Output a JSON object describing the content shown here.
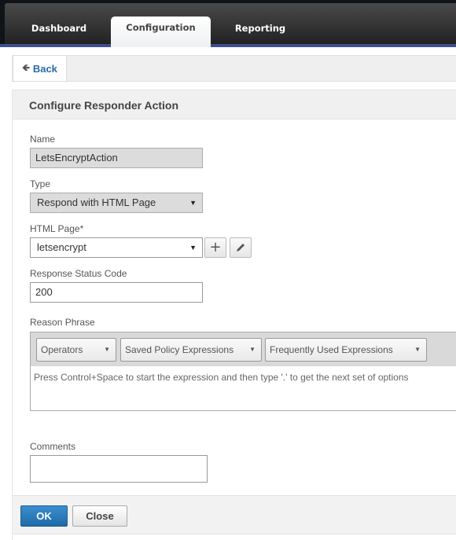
{
  "nav": {
    "tabs": [
      {
        "label": "Dashboard",
        "active": false
      },
      {
        "label": "Configuration",
        "active": true
      },
      {
        "label": "Reporting",
        "active": false
      }
    ]
  },
  "back": {
    "label": "Back",
    "icon": "arrow-left-icon"
  },
  "panel": {
    "title": "Configure Responder Action",
    "fields": {
      "name": {
        "label": "Name",
        "value": "LetsEncryptAction"
      },
      "type": {
        "label": "Type",
        "value": "Respond with HTML Page"
      },
      "html_page": {
        "label": "HTML Page*",
        "value": "letsencrypt",
        "add_icon": "plus-icon",
        "edit_icon": "pencil-icon"
      },
      "status_code": {
        "label": "Response Status Code",
        "value": "200"
      },
      "reason_phrase": {
        "label": "Reason Phrase",
        "dropdowns": [
          "Operators",
          "Saved Policy Expressions",
          "Frequently Used Expressions"
        ],
        "hint": "Press Control+Space to start the expression and then type '.' to get the next set of options"
      },
      "comments": {
        "label": "Comments",
        "value": ""
      }
    }
  },
  "footer": {
    "ok_label": "OK",
    "close_label": "Close"
  },
  "colors": {
    "accent": "#2c6aa8",
    "ok_button": "#2a7bbd",
    "nav_stripe": "#3d4f8c"
  }
}
